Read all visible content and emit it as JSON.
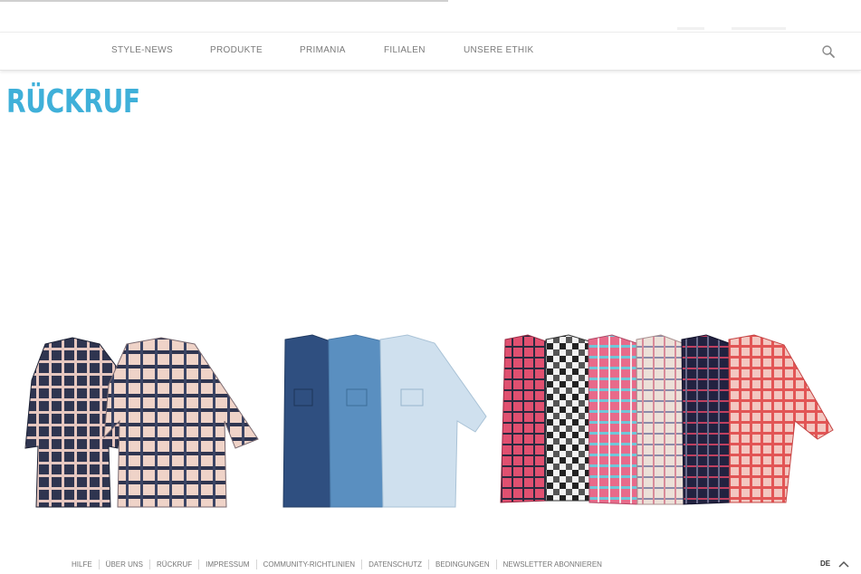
{
  "nav": {
    "items": [
      {
        "label": "STYLE-NEWS"
      },
      {
        "label": "PRODUKTE"
      },
      {
        "label": "PRIMANIA"
      },
      {
        "label": "FILIALEN"
      },
      {
        "label": "UNSERE ETHIK"
      }
    ],
    "search_icon": "search-icon"
  },
  "page": {
    "title": "RÜCKRUF",
    "title_color": "#3fb0d9"
  },
  "products": {
    "groups": [
      {
        "name": "checked-shirts-pair",
        "count": 2,
        "colors": [
          "#2f3550",
          "#e9c9c0"
        ]
      },
      {
        "name": "denim-shirts",
        "count": 3,
        "colors": [
          "#2f4f80",
          "#5a8fc0",
          "#cfe0ee"
        ]
      },
      {
        "name": "checked-shirts-row",
        "count": 6,
        "colors": [
          "#e05070",
          "#2a2a2a",
          "#e86a8a",
          "#e8d8d0",
          "#222240",
          "#e56060"
        ]
      }
    ]
  },
  "footer": {
    "links": [
      {
        "label": "HILFE"
      },
      {
        "label": "ÜBER UNS"
      },
      {
        "label": "RÜCKRUF"
      },
      {
        "label": "IMPRESSUM"
      },
      {
        "label": "COMMUNITY-RICHTLINIEN"
      },
      {
        "label": "DATENSCHUTZ"
      },
      {
        "label": "BEDINGUNGEN"
      },
      {
        "label": "NEWSLETTER ABONNIEREN"
      }
    ],
    "language": "DE",
    "scroll_icon": "chevron-up-icon"
  }
}
